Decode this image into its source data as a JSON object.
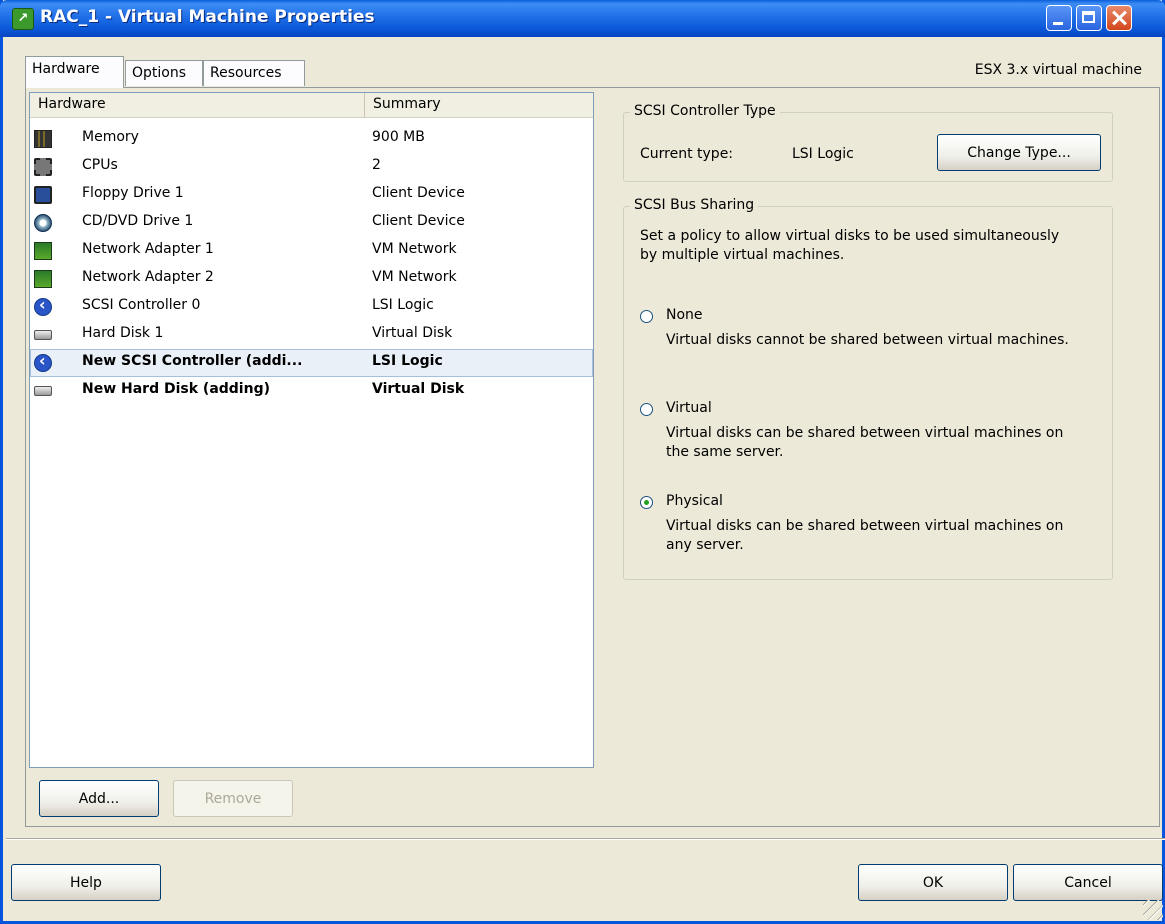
{
  "window": {
    "title": "RAC_1 - Virtual Machine Properties",
    "vm_version": "ESX 3.x virtual machine"
  },
  "tabs": [
    {
      "label": "Hardware"
    },
    {
      "label": "Options"
    },
    {
      "label": "Resources"
    }
  ],
  "hardware_list": {
    "columns": [
      "Hardware",
      "Summary"
    ],
    "rows": [
      {
        "name": "Memory",
        "summary": "900 MB",
        "icon": "memory-icon"
      },
      {
        "name": "CPUs",
        "summary": "2",
        "icon": "cpu-icon"
      },
      {
        "name": "Floppy Drive 1",
        "summary": "Client Device",
        "icon": "floppy-icon"
      },
      {
        "name": "CD/DVD Drive 1",
        "summary": "Client Device",
        "icon": "cd-dvd-icon"
      },
      {
        "name": "Network Adapter 1",
        "summary": "VM Network",
        "icon": "network-adapter-icon"
      },
      {
        "name": "Network Adapter 2",
        "summary": "VM Network",
        "icon": "network-adapter-icon"
      },
      {
        "name": "SCSI Controller 0",
        "summary": "LSI Logic",
        "icon": "scsi-controller-icon"
      },
      {
        "name": "Hard Disk 1",
        "summary": "Virtual Disk",
        "icon": "hard-disk-icon"
      },
      {
        "name": "New SCSI Controller (addi...",
        "summary": "LSI Logic",
        "icon": "scsi-controller-icon"
      },
      {
        "name": "New Hard Disk (adding)",
        "summary": "Virtual Disk",
        "icon": "hard-disk-icon"
      }
    ],
    "selected_index": 8
  },
  "list_buttons": {
    "add": "Add...",
    "remove": "Remove"
  },
  "scsi_type": {
    "legend": "SCSI Controller Type",
    "current_label": "Current type:",
    "current_value": "LSI Logic",
    "change_button": "Change Type..."
  },
  "bus_sharing": {
    "legend": "SCSI Bus Sharing",
    "description": "Set a policy to allow virtual disks to be used simultaneously by multiple virtual machines.",
    "options": [
      {
        "label": "None",
        "description": "Virtual disks cannot be shared between virtual machines."
      },
      {
        "label": "Virtual",
        "description": "Virtual disks can be shared between virtual machines on the same server."
      },
      {
        "label": "Physical",
        "description": "Virtual disks can be shared between virtual machines on any server."
      }
    ],
    "selected": "Physical"
  },
  "footer": {
    "help": "Help",
    "ok": "OK",
    "cancel": "Cancel"
  }
}
